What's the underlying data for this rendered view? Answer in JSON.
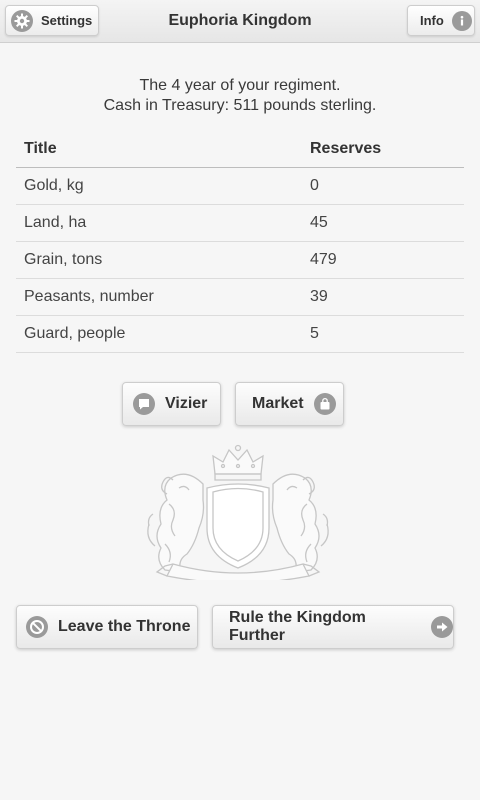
{
  "header": {
    "settings_label": "Settings",
    "title": "Euphoria Kingdom",
    "info_label": "Info"
  },
  "intro": {
    "line1": "The 4 year of your regiment.",
    "line2": "Cash in Treasury: 511 pounds sterling."
  },
  "table": {
    "headers": [
      "Title",
      "Reserves"
    ],
    "rows": [
      [
        "Gold, kg",
        "0"
      ],
      [
        "Land, ha",
        "45"
      ],
      [
        "Grain, tons",
        "479"
      ],
      [
        "Peasants, number",
        "39"
      ],
      [
        "Guard, people",
        "5"
      ]
    ]
  },
  "buttons": {
    "vizier": "Vizier",
    "market": "Market",
    "leave": "Leave the Throne",
    "rule": "Rule the Kingdom Further"
  },
  "icons": {
    "settings": "gear-icon",
    "info": "info-icon",
    "vizier": "chat-bubble-icon",
    "market": "shopping-bag-icon",
    "leave": "no-entry-icon",
    "rule": "arrow-right-icon"
  }
}
